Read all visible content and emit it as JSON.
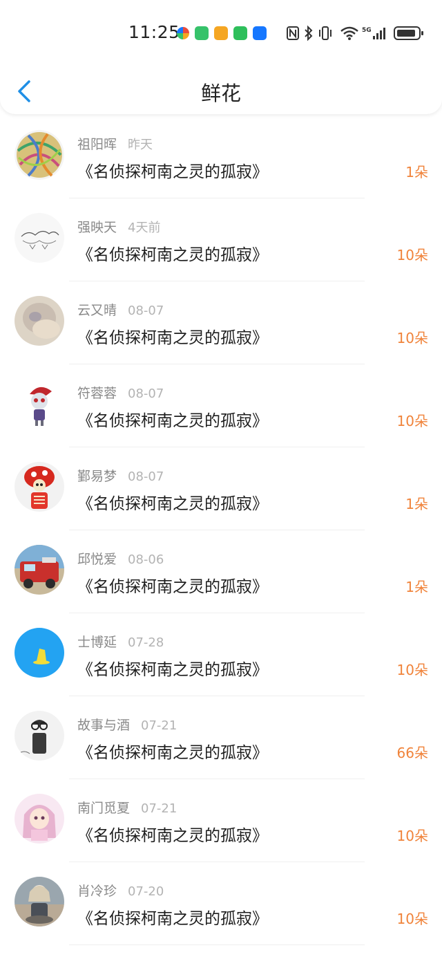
{
  "status_bar": {
    "time": "11:25",
    "network_label": "5G",
    "app_icon_colors": [
      "#e94c3d",
      "#36c26a",
      "#f5a623",
      "#2ebf5b",
      "#1677ff"
    ]
  },
  "header": {
    "title": "鲜花",
    "back_icon": "chevron-left-icon",
    "accent_color": "#1f8fe6"
  },
  "flower_color": "#f0833a",
  "records": [
    {
      "name": "祖阳晖",
      "time": "昨天",
      "book": "《名侦探柯南之灵的孤寂》",
      "count": "1朵"
    },
    {
      "name": "强映天",
      "time": "4天前",
      "book": "《名侦探柯南之灵的孤寂》",
      "count": "10朵"
    },
    {
      "name": "云又晴",
      "time": "08-07",
      "book": "《名侦探柯南之灵的孤寂》",
      "count": "10朵"
    },
    {
      "name": "符蓉蓉",
      "time": "08-07",
      "book": "《名侦探柯南之灵的孤寂》",
      "count": "10朵"
    },
    {
      "name": "鄞易梦",
      "time": "08-07",
      "book": "《名侦探柯南之灵的孤寂》",
      "count": "1朵"
    },
    {
      "name": "邱悦爱",
      "time": "08-06",
      "book": "《名侦探柯南之灵的孤寂》",
      "count": "1朵"
    },
    {
      "name": "士博延",
      "time": "07-28",
      "book": "《名侦探柯南之灵的孤寂》",
      "count": "10朵"
    },
    {
      "name": "故事与酒",
      "time": "07-21",
      "book": "《名侦探柯南之灵的孤寂》",
      "count": "66朵"
    },
    {
      "name": "南门觅夏",
      "time": "07-21",
      "book": "《名侦探柯南之灵的孤寂》",
      "count": "10朵"
    },
    {
      "name": "肖冷珍",
      "time": "07-20",
      "book": "《名侦探柯南之灵的孤寂》",
      "count": "10朵"
    }
  ]
}
